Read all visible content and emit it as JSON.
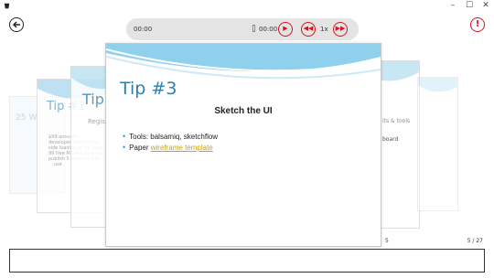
{
  "window": {
    "minimize": "–",
    "maximize": "☐",
    "close": "✕"
  },
  "player": {
    "time_elapsed": "00:00",
    "time_total": "00:00",
    "speed": "1x"
  },
  "slides": {
    "back_slide_left": {
      "title": "25 W"
    },
    "left2": {
      "title": "Tip #1",
      "bullets": [
        "$99 annually",
        "developer credentials",
        "side loading ok 50 apps",
        "99 free Marketplace apps",
        "publish 5 apps for free"
      ],
      "sub": "use"
    },
    "left3": {
      "title": "Tip",
      "sub": "Regis"
    },
    "right2": {
      "title": "its & tools",
      "text": "board"
    },
    "main": {
      "title": "Tip #3",
      "heading": "Sketch the UI",
      "bullet1": "Tools: balsamiq, sketchflow",
      "bullet2_prefix": "Paper ",
      "bullet2_link": "wireframe template"
    }
  },
  "page": {
    "left_index": "5",
    "indicator": "5 / 27"
  }
}
